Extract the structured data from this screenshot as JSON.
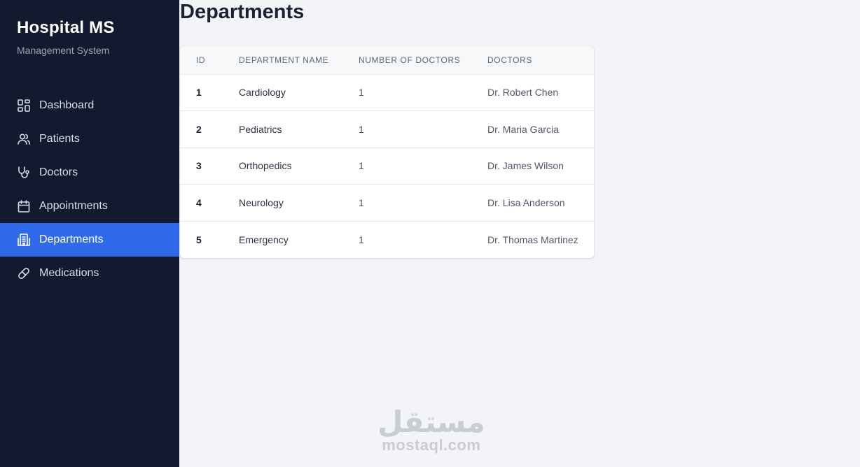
{
  "brand": {
    "title": "Hospital MS",
    "subtitle": "Management System"
  },
  "nav": {
    "items": [
      {
        "label": "Dashboard",
        "icon": "dashboard-grid-icon",
        "active": false
      },
      {
        "label": "Patients",
        "icon": "users-icon",
        "active": false
      },
      {
        "label": "Doctors",
        "icon": "stethoscope-icon",
        "active": false
      },
      {
        "label": "Appointments",
        "icon": "calendar-icon",
        "active": false
      },
      {
        "label": "Departments",
        "icon": "building-icon",
        "active": true
      },
      {
        "label": "Medications",
        "icon": "pill-icon",
        "active": false
      }
    ]
  },
  "page": {
    "title": "Departments"
  },
  "table": {
    "headers": [
      "ID",
      "DEPARTMENT NAME",
      "NUMBER OF DOCTORS",
      "DOCTORS"
    ],
    "rows": [
      {
        "id": "1",
        "name": "Cardiology",
        "count": "1",
        "doctors": "Dr. Robert Chen"
      },
      {
        "id": "2",
        "name": "Pediatrics",
        "count": "1",
        "doctors": "Dr. Maria Garcia"
      },
      {
        "id": "3",
        "name": "Orthopedics",
        "count": "1",
        "doctors": "Dr. James Wilson"
      },
      {
        "id": "4",
        "name": "Neurology",
        "count": "1",
        "doctors": "Dr. Lisa Anderson"
      },
      {
        "id": "5",
        "name": "Emergency",
        "count": "1",
        "doctors": "Dr. Thomas Martinez"
      }
    ]
  },
  "watermark": {
    "arabic": "مستقل",
    "latin": "mostaql.com"
  },
  "colors": {
    "sidebar_bg": "#111a2e",
    "accent": "#2f6ae8",
    "page_bg": "#f3f4f7"
  }
}
